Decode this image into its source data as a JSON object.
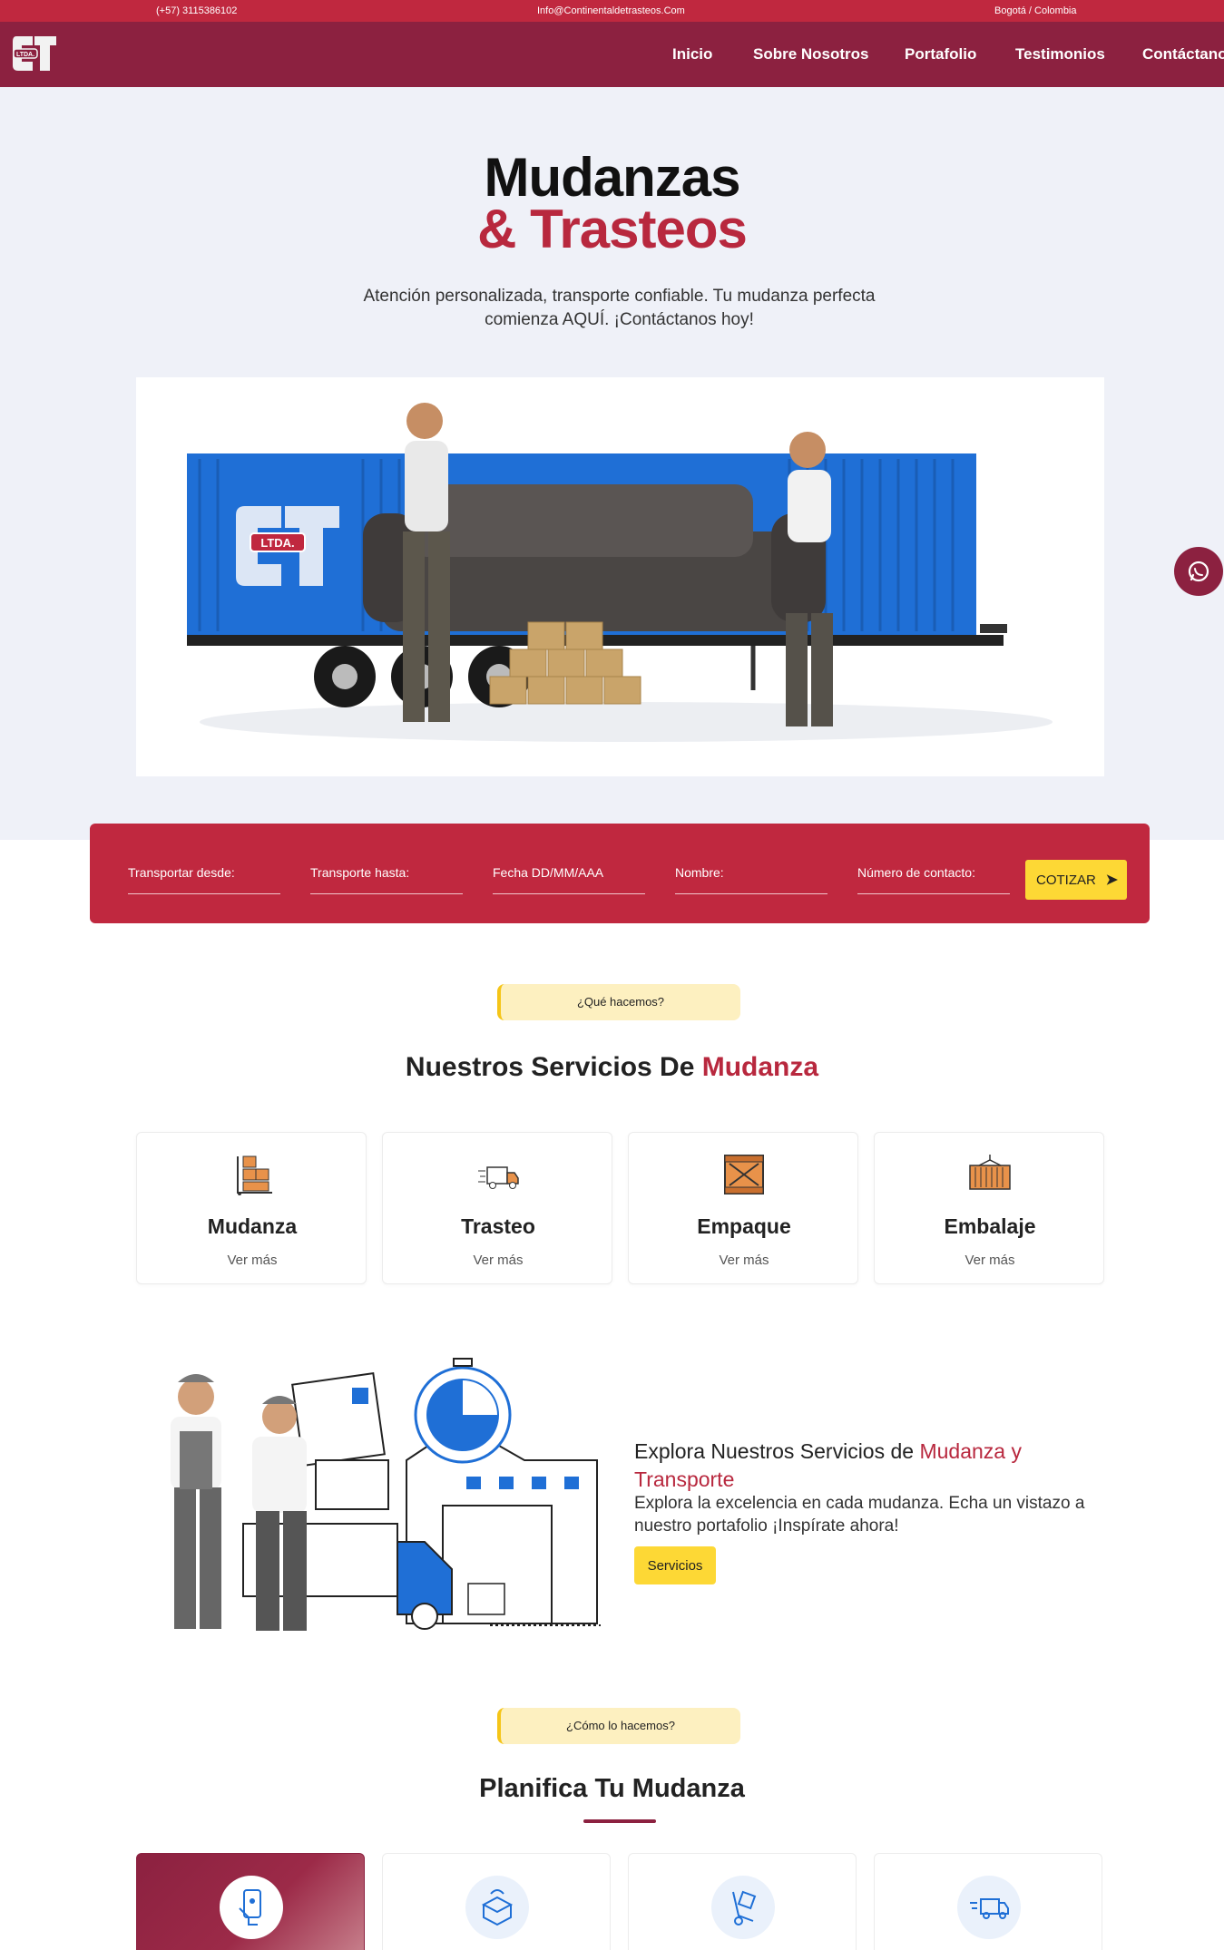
{
  "topbar": {
    "phone": "(+57) 3115386102",
    "email": "Info@Continentaldetrasteos.Com",
    "location": "Bogotá / Colombia"
  },
  "nav": {
    "logo_text": "LTDA.",
    "items": [
      "Inicio",
      "Sobre Nosotros",
      "Portafolio",
      "Testimonios",
      "Contáctanos"
    ]
  },
  "hero": {
    "title_line1": "Mudanzas",
    "title_line2": "& Trasteos",
    "subtitle": "Atención personalizada, transporte confiable. Tu mudanza perfecta comienza AQUÍ. ¡Contáctanos hoy!",
    "truck_logo": "LTDA."
  },
  "quote_form": {
    "fields": [
      "Transportar desde:",
      "Transporte hasta:",
      "Fecha DD/MM/AAA",
      "Nombre:",
      "Número de contacto:"
    ],
    "submit_label": "COTIZAR"
  },
  "services": {
    "pill": "¿Qué hacemos?",
    "title_black": "Nuestros Servicios De ",
    "title_red": "Mudanza",
    "cards": [
      {
        "title": "Mudanza",
        "link": "Ver más",
        "icon": "boxes-cart-icon"
      },
      {
        "title": "Trasteo",
        "link": "Ver más",
        "icon": "delivery-truck-icon"
      },
      {
        "title": "Empaque",
        "link": "Ver más",
        "icon": "wooden-crate-icon"
      },
      {
        "title": "Embalaje",
        "link": "Ver más",
        "icon": "cargo-container-icon"
      }
    ]
  },
  "explore": {
    "title_black": "Explora Nuestros Servicios de ",
    "title_red": "Mudanza y Transporte",
    "text": "Explora la excelencia en cada mudanza. Echa un vistazo a nuestro portafolio ¡Inspírate ahora!",
    "button": "Servicios"
  },
  "plan": {
    "pill": "¿Cómo lo hacemos?",
    "title": "Planifica Tu Mudanza",
    "cards": [
      {
        "icon": "phone-touch-icon",
        "active": true
      },
      {
        "icon": "packing-box-icon",
        "active": false
      },
      {
        "icon": "hand-truck-icon",
        "active": false
      },
      {
        "icon": "fast-delivery-icon",
        "active": false
      }
    ]
  },
  "colors": {
    "brand_maroon": "#8c2140",
    "brand_red": "#c0283f",
    "accent_yellow": "#fdd835",
    "hero_bg": "#eff1f8"
  }
}
